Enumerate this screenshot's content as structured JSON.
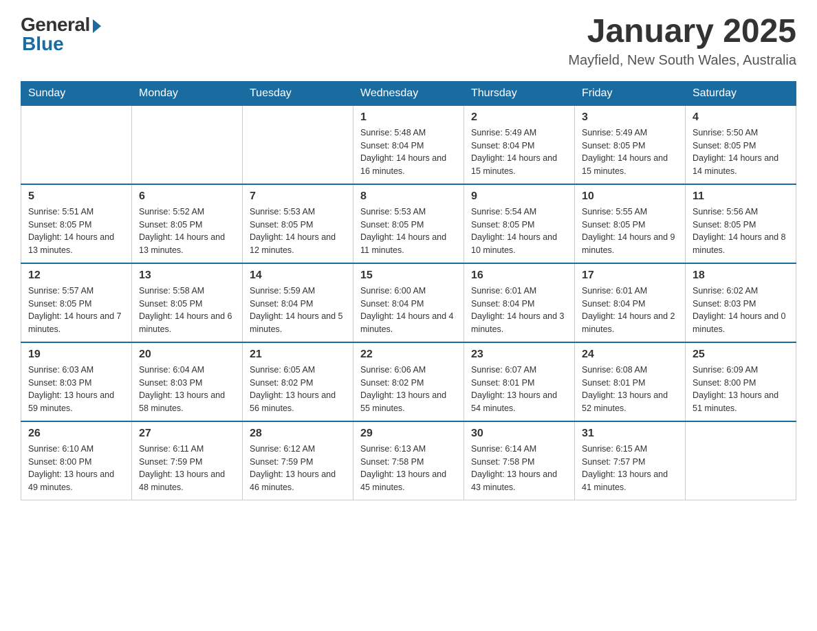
{
  "logo": {
    "general": "General",
    "blue": "Blue"
  },
  "title": "January 2025",
  "location": "Mayfield, New South Wales, Australia",
  "days_of_week": [
    "Sunday",
    "Monday",
    "Tuesday",
    "Wednesday",
    "Thursday",
    "Friday",
    "Saturday"
  ],
  "weeks": [
    [
      {
        "day": "",
        "sunrise": "",
        "sunset": "",
        "daylight": ""
      },
      {
        "day": "",
        "sunrise": "",
        "sunset": "",
        "daylight": ""
      },
      {
        "day": "",
        "sunrise": "",
        "sunset": "",
        "daylight": ""
      },
      {
        "day": "1",
        "sunrise": "Sunrise: 5:48 AM",
        "sunset": "Sunset: 8:04 PM",
        "daylight": "Daylight: 14 hours and 16 minutes."
      },
      {
        "day": "2",
        "sunrise": "Sunrise: 5:49 AM",
        "sunset": "Sunset: 8:04 PM",
        "daylight": "Daylight: 14 hours and 15 minutes."
      },
      {
        "day": "3",
        "sunrise": "Sunrise: 5:49 AM",
        "sunset": "Sunset: 8:05 PM",
        "daylight": "Daylight: 14 hours and 15 minutes."
      },
      {
        "day": "4",
        "sunrise": "Sunrise: 5:50 AM",
        "sunset": "Sunset: 8:05 PM",
        "daylight": "Daylight: 14 hours and 14 minutes."
      }
    ],
    [
      {
        "day": "5",
        "sunrise": "Sunrise: 5:51 AM",
        "sunset": "Sunset: 8:05 PM",
        "daylight": "Daylight: 14 hours and 13 minutes."
      },
      {
        "day": "6",
        "sunrise": "Sunrise: 5:52 AM",
        "sunset": "Sunset: 8:05 PM",
        "daylight": "Daylight: 14 hours and 13 minutes."
      },
      {
        "day": "7",
        "sunrise": "Sunrise: 5:53 AM",
        "sunset": "Sunset: 8:05 PM",
        "daylight": "Daylight: 14 hours and 12 minutes."
      },
      {
        "day": "8",
        "sunrise": "Sunrise: 5:53 AM",
        "sunset": "Sunset: 8:05 PM",
        "daylight": "Daylight: 14 hours and 11 minutes."
      },
      {
        "day": "9",
        "sunrise": "Sunrise: 5:54 AM",
        "sunset": "Sunset: 8:05 PM",
        "daylight": "Daylight: 14 hours and 10 minutes."
      },
      {
        "day": "10",
        "sunrise": "Sunrise: 5:55 AM",
        "sunset": "Sunset: 8:05 PM",
        "daylight": "Daylight: 14 hours and 9 minutes."
      },
      {
        "day": "11",
        "sunrise": "Sunrise: 5:56 AM",
        "sunset": "Sunset: 8:05 PM",
        "daylight": "Daylight: 14 hours and 8 minutes."
      }
    ],
    [
      {
        "day": "12",
        "sunrise": "Sunrise: 5:57 AM",
        "sunset": "Sunset: 8:05 PM",
        "daylight": "Daylight: 14 hours and 7 minutes."
      },
      {
        "day": "13",
        "sunrise": "Sunrise: 5:58 AM",
        "sunset": "Sunset: 8:05 PM",
        "daylight": "Daylight: 14 hours and 6 minutes."
      },
      {
        "day": "14",
        "sunrise": "Sunrise: 5:59 AM",
        "sunset": "Sunset: 8:04 PM",
        "daylight": "Daylight: 14 hours and 5 minutes."
      },
      {
        "day": "15",
        "sunrise": "Sunrise: 6:00 AM",
        "sunset": "Sunset: 8:04 PM",
        "daylight": "Daylight: 14 hours and 4 minutes."
      },
      {
        "day": "16",
        "sunrise": "Sunrise: 6:01 AM",
        "sunset": "Sunset: 8:04 PM",
        "daylight": "Daylight: 14 hours and 3 minutes."
      },
      {
        "day": "17",
        "sunrise": "Sunrise: 6:01 AM",
        "sunset": "Sunset: 8:04 PM",
        "daylight": "Daylight: 14 hours and 2 minutes."
      },
      {
        "day": "18",
        "sunrise": "Sunrise: 6:02 AM",
        "sunset": "Sunset: 8:03 PM",
        "daylight": "Daylight: 14 hours and 0 minutes."
      }
    ],
    [
      {
        "day": "19",
        "sunrise": "Sunrise: 6:03 AM",
        "sunset": "Sunset: 8:03 PM",
        "daylight": "Daylight: 13 hours and 59 minutes."
      },
      {
        "day": "20",
        "sunrise": "Sunrise: 6:04 AM",
        "sunset": "Sunset: 8:03 PM",
        "daylight": "Daylight: 13 hours and 58 minutes."
      },
      {
        "day": "21",
        "sunrise": "Sunrise: 6:05 AM",
        "sunset": "Sunset: 8:02 PM",
        "daylight": "Daylight: 13 hours and 56 minutes."
      },
      {
        "day": "22",
        "sunrise": "Sunrise: 6:06 AM",
        "sunset": "Sunset: 8:02 PM",
        "daylight": "Daylight: 13 hours and 55 minutes."
      },
      {
        "day": "23",
        "sunrise": "Sunrise: 6:07 AM",
        "sunset": "Sunset: 8:01 PM",
        "daylight": "Daylight: 13 hours and 54 minutes."
      },
      {
        "day": "24",
        "sunrise": "Sunrise: 6:08 AM",
        "sunset": "Sunset: 8:01 PM",
        "daylight": "Daylight: 13 hours and 52 minutes."
      },
      {
        "day": "25",
        "sunrise": "Sunrise: 6:09 AM",
        "sunset": "Sunset: 8:00 PM",
        "daylight": "Daylight: 13 hours and 51 minutes."
      }
    ],
    [
      {
        "day": "26",
        "sunrise": "Sunrise: 6:10 AM",
        "sunset": "Sunset: 8:00 PM",
        "daylight": "Daylight: 13 hours and 49 minutes."
      },
      {
        "day": "27",
        "sunrise": "Sunrise: 6:11 AM",
        "sunset": "Sunset: 7:59 PM",
        "daylight": "Daylight: 13 hours and 48 minutes."
      },
      {
        "day": "28",
        "sunrise": "Sunrise: 6:12 AM",
        "sunset": "Sunset: 7:59 PM",
        "daylight": "Daylight: 13 hours and 46 minutes."
      },
      {
        "day": "29",
        "sunrise": "Sunrise: 6:13 AM",
        "sunset": "Sunset: 7:58 PM",
        "daylight": "Daylight: 13 hours and 45 minutes."
      },
      {
        "day": "30",
        "sunrise": "Sunrise: 6:14 AM",
        "sunset": "Sunset: 7:58 PM",
        "daylight": "Daylight: 13 hours and 43 minutes."
      },
      {
        "day": "31",
        "sunrise": "Sunrise: 6:15 AM",
        "sunset": "Sunset: 7:57 PM",
        "daylight": "Daylight: 13 hours and 41 minutes."
      },
      {
        "day": "",
        "sunrise": "",
        "sunset": "",
        "daylight": ""
      }
    ]
  ]
}
